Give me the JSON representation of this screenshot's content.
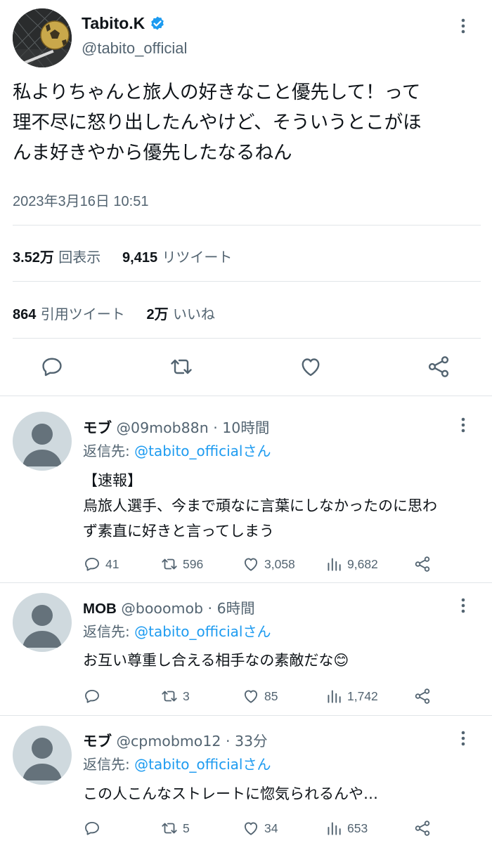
{
  "tweet": {
    "display_name": "Tabito.K",
    "handle": "@tabito_official",
    "text_line1": "私よりちゃんと旅人の好きなこと優先して！って",
    "text_line2": "理不尽に怒り出したんやけど、そういうとこがほ",
    "text_line3": "んま好きやから優先したなるねん",
    "timestamp": "2023年3月16日 10:51",
    "views_count": "3.52万",
    "views_label": "回表示",
    "retweets_count": "9,415",
    "retweets_label": "リツイート",
    "quotes_count": "864",
    "quotes_label": "引用ツイート",
    "likes_count": "2万",
    "likes_label": "いいね"
  },
  "replies": [
    {
      "name": "モブ",
      "handle_time": "@09mob88n · 10時間",
      "reply_prefix": "返信先: ",
      "reply_to": "@tabito_officialさん",
      "lines": [
        "【速報】",
        "烏旅人選手、今まで頑なに言葉にしなかったのに思わ",
        "ず素直に好きと言ってしまう"
      ],
      "replies": "41",
      "retweets": "596",
      "likes": "3,058",
      "views": "9,682"
    },
    {
      "name": "MOB",
      "handle_time": "@booomob · 6時間",
      "reply_prefix": "返信先: ",
      "reply_to": "@tabito_officialさん",
      "lines": [
        "お互い尊重し合える相手なの素敵だな😊"
      ],
      "replies": "",
      "retweets": "3",
      "likes": "85",
      "views": "1,742"
    },
    {
      "name": "モブ",
      "handle_time": "@cpmobmo12 · 33分",
      "reply_prefix": "返信先: ",
      "reply_to": "@tabito_officialさん",
      "lines": [
        "この人こんなストレートに惚気られるんや…"
      ],
      "replies": "",
      "retweets": "5",
      "likes": "34",
      "views": "653"
    }
  ],
  "colors": {
    "link": "#1d9bf0",
    "secondary_text": "#536471",
    "primary_text": "#0f1419",
    "verified": "#1d9bf0"
  }
}
